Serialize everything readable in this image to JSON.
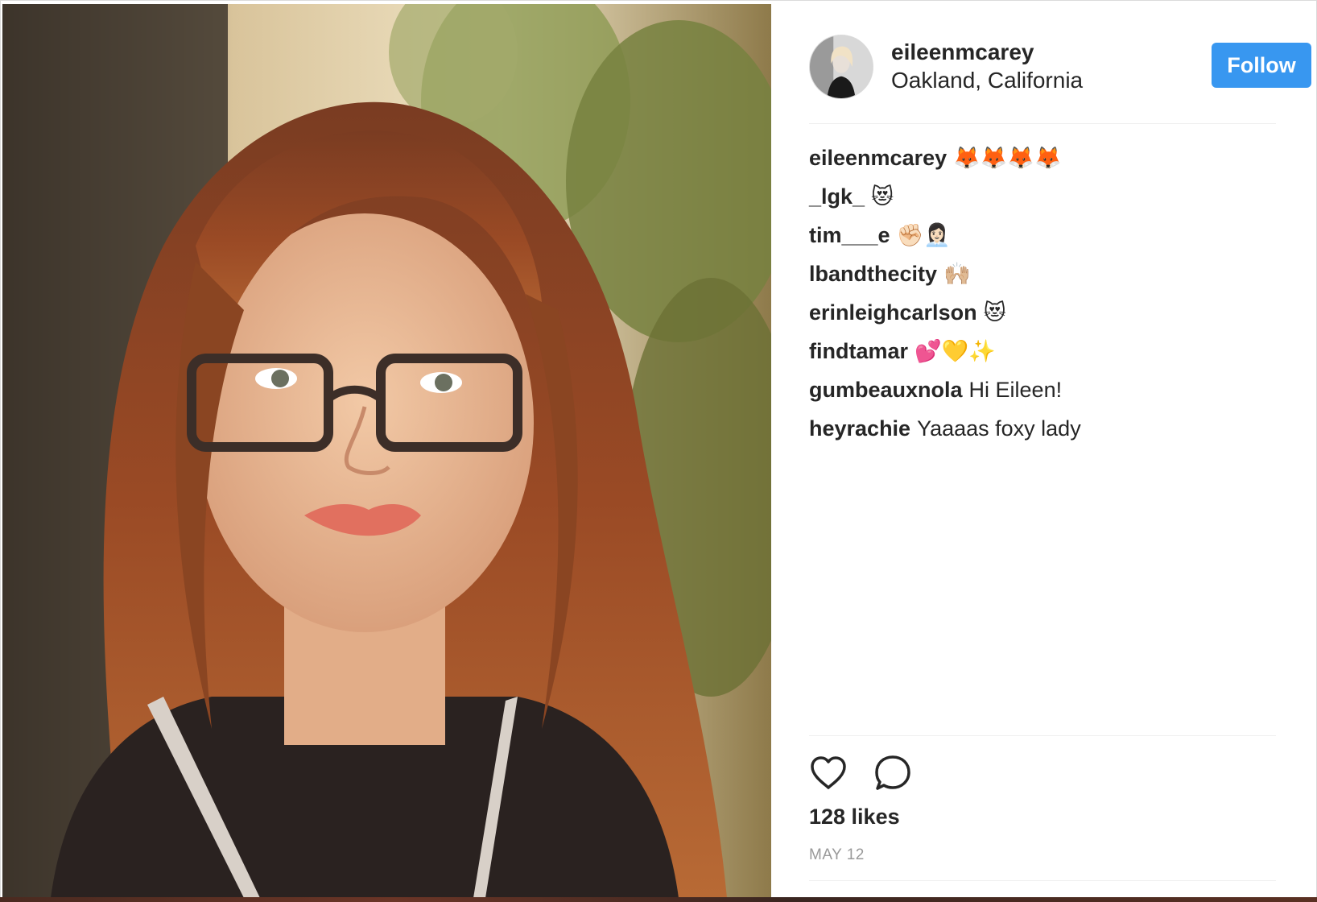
{
  "post": {
    "photo": {
      "icon": "portrait-photo"
    },
    "header": {
      "avatar_icon": "profile-avatar",
      "username": "eileenmcarey",
      "location": "Oakland, California",
      "follow_label": "Follow"
    },
    "comments": [
      {
        "user": "eileenmcarey",
        "text": "🦊🦊🦊🦊"
      },
      {
        "user": "_lgk_",
        "text": "😻"
      },
      {
        "user": "tim___e",
        "text": "✊🏻👩🏻‍💼"
      },
      {
        "user": "lbandthecity",
        "text": "🙌🏼"
      },
      {
        "user": "erinleighcarlson",
        "text": "😻"
      },
      {
        "user": "findtamar",
        "text": "💕💛✨"
      },
      {
        "user": "gumbeauxnola",
        "text": "Hi Eileen!"
      },
      {
        "user": "heyrachie",
        "text": "Yaaaas foxy lady"
      }
    ],
    "actions": {
      "like_icon": "heart-icon",
      "comment_icon": "comment-icon"
    },
    "likes": "128 likes",
    "date": "MAY 12"
  },
  "colors": {
    "follow_button": "#3897f0",
    "text": "#262626",
    "muted": "#999999",
    "divider": "#efefef"
  }
}
